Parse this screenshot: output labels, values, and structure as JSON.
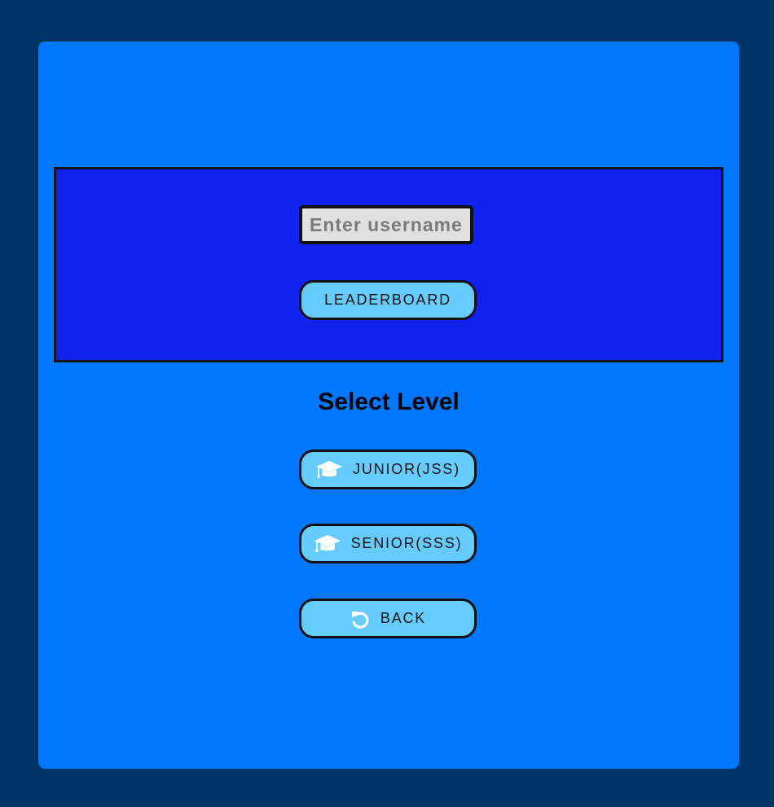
{
  "user_panel": {
    "username_placeholder": "Enter username",
    "leaderboard_label": "LEADERBOARD"
  },
  "level_section": {
    "heading": "Select Level",
    "buttons": [
      {
        "label": "JUNIOR(JSS)",
        "icon": "graduation-cap-icon"
      },
      {
        "label": "SENIOR(SSS)",
        "icon": "graduation-cap-icon"
      },
      {
        "label": "BACK",
        "icon": "undo-icon"
      }
    ]
  },
  "colors": {
    "background": "#003366",
    "card": "#0077ff",
    "panel": "#1122ee",
    "button": "#66ccff",
    "input": "#e0e0e0"
  }
}
